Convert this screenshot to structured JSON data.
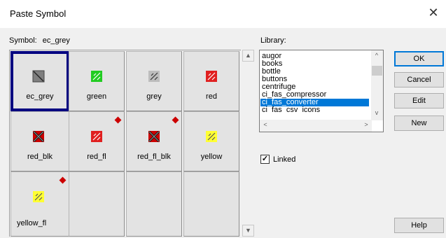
{
  "window": {
    "title": "Paste Symbol",
    "close_glyph": "✕"
  },
  "symbol": {
    "label": "Symbol:",
    "value": "ec_grey"
  },
  "tiles": [
    {
      "name": "ec_grey",
      "icon": "grey-square-icon",
      "color": "#7f7f7f",
      "selected": true,
      "flag": false
    },
    {
      "name": "green",
      "icon": "green-symbol-icon",
      "color": "#22cc22",
      "selected": false,
      "flag": false
    },
    {
      "name": "grey",
      "icon": "grey-symbol-icon",
      "color": "#8c8c8c",
      "selected": false,
      "flag": false
    },
    {
      "name": "red",
      "icon": "red-symbol-icon",
      "color": "#e02020",
      "selected": false,
      "flag": false
    },
    {
      "name": "red_blk",
      "icon": "red-black-x-icon",
      "color": "#cc0000",
      "selected": false,
      "flag": false
    },
    {
      "name": "red_fl",
      "icon": "red-flash-symbol-icon",
      "color": "#e02020",
      "selected": false,
      "flag": true
    },
    {
      "name": "red_fl_blk",
      "icon": "red-black-flash-x-icon",
      "color": "#cc0000",
      "selected": false,
      "flag": true
    },
    {
      "name": "yellow",
      "icon": "yellow-symbol-icon",
      "color": "#ffff33",
      "selected": false,
      "flag": false
    },
    {
      "name": "yellow_fl",
      "icon": "yellow-flash-symbol-icon",
      "color": "#ffff33",
      "selected": false,
      "flag": true
    }
  ],
  "library": {
    "label": "Library:",
    "items": [
      "augor",
      "books",
      "bottle",
      "buttons",
      "centrifuge",
      "ci_fas_compressor",
      "ci_fas_converter",
      "ci_fas_csv_icons"
    ],
    "selected": "ci_fas_converter"
  },
  "linked": {
    "label": "Linked",
    "checked": true,
    "glyph": "✓"
  },
  "buttons": {
    "ok": "OK",
    "cancel": "Cancel",
    "edit": "Edit",
    "new": "New",
    "help": "Help"
  },
  "scroll_glyphs": {
    "up": "▲",
    "down": "▼",
    "left": "<",
    "right": ">",
    "lib_up": "^",
    "lib_down": "v"
  },
  "accent_color": "#0078d7",
  "selection_border_color": "#000080"
}
